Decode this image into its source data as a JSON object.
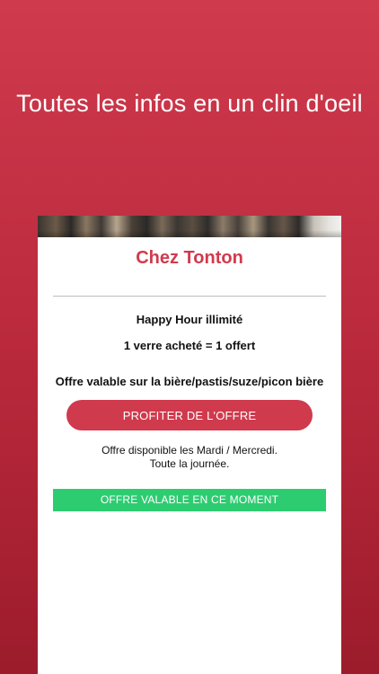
{
  "headline": "Toutes les infos en un clin d'oeil",
  "venue": {
    "name": "Chez Tonton"
  },
  "offer": {
    "title": "Happy Hour illimité",
    "description": "1 verre acheté = 1 offert",
    "validity": "Offre valable sur la bière/pastis/suze/picon bière",
    "cta_label": "PROFITER DE L'OFFRE",
    "availability_days": "Offre disponible les Mardi / Mercredi.",
    "availability_hours": "Toute la journée.",
    "status_label": "OFFRE VALABLE EN CE MOMENT"
  },
  "colors": {
    "brand": "#d03a4d",
    "status_ok": "#2ecc71"
  }
}
